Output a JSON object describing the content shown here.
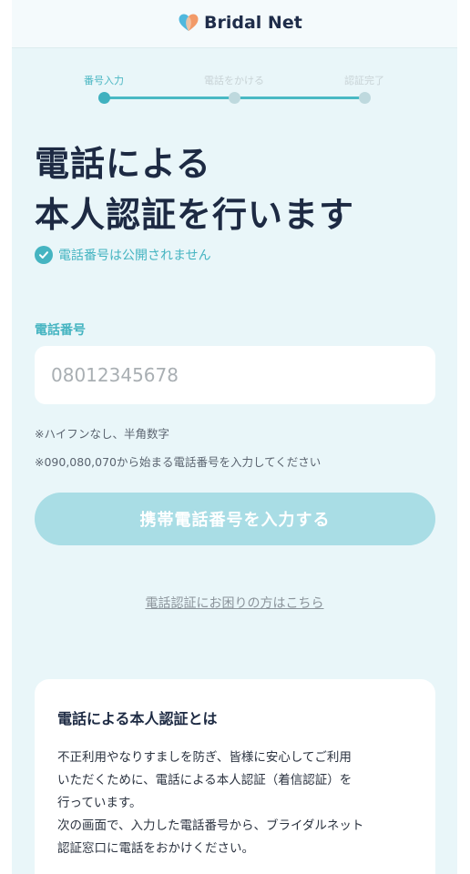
{
  "header": {
    "brand": "Bridal Net"
  },
  "stepper": {
    "steps": [
      {
        "label": "番号入力",
        "active": true
      },
      {
        "label": "電話をかける",
        "active": false
      },
      {
        "label": "認証完了",
        "active": false
      }
    ]
  },
  "heading": {
    "line1": "電話による",
    "line2": "本人認証を行います"
  },
  "notice": {
    "text": "電話番号は公開されません",
    "icon": "check-circle-icon"
  },
  "form": {
    "label": "電話番号",
    "placeholder": "08012345678",
    "value": "",
    "hint1": "※ハイフンなし、半角数字",
    "hint2": "※090,080,070から始まる電話番号を入力してください",
    "submit_label": "携帯電話番号を入力する"
  },
  "help": {
    "link_text": "電話認証にお困りの方はこちら"
  },
  "info": {
    "title": "電話による本人認証とは",
    "lines": [
      "不正利用やなりすましを防ぎ、皆様に安心してご利用",
      "いただくために、電話による本人認証（着信認証）を",
      "行っています。",
      "次の画面で、入力した電話番号から、ブライダルネット",
      "認証窓口に電話をおかけください。"
    ]
  },
  "colors": {
    "accent": "#45b4c1",
    "background": "#e9f6f9",
    "button_disabled": "#a9dde5",
    "heading": "#1d2a43"
  }
}
